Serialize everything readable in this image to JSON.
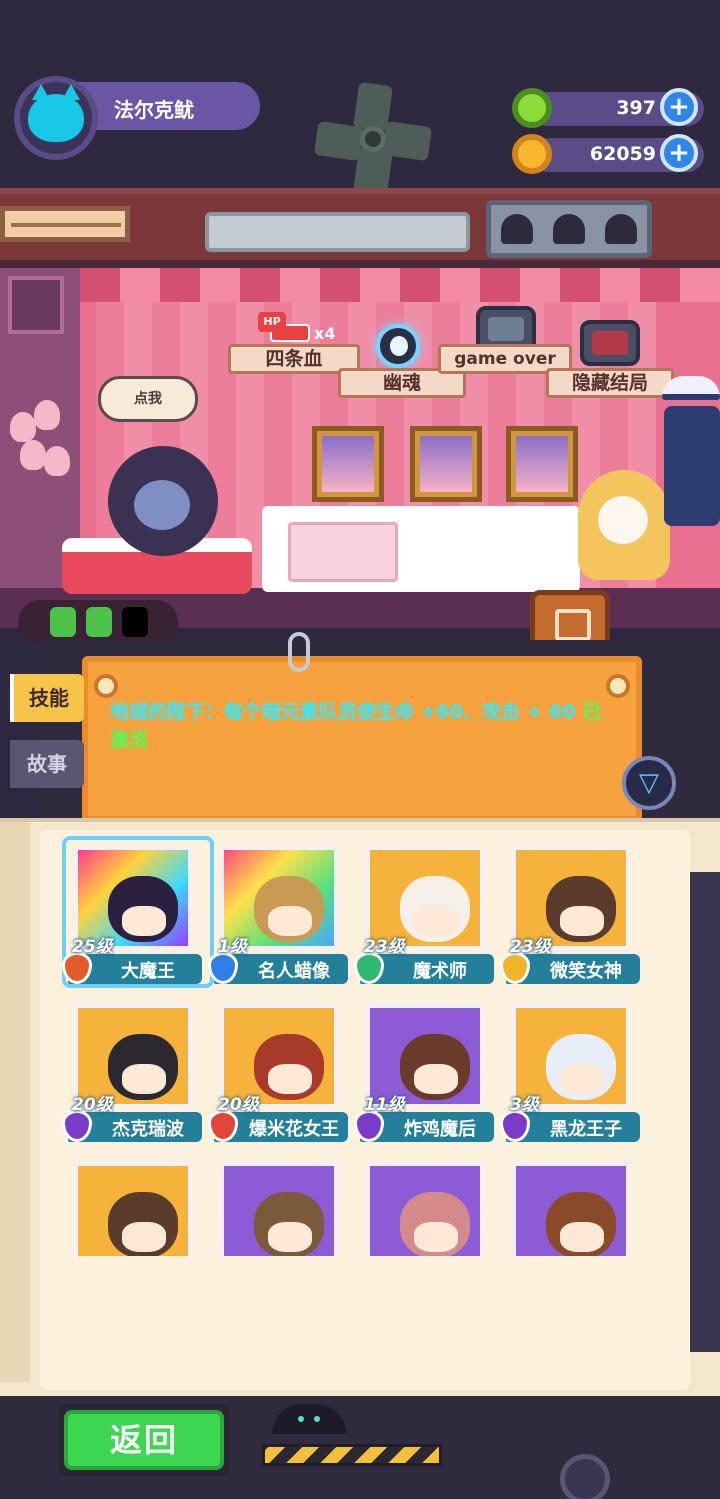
{
  "player": {
    "name": "法尔克鱿",
    "avatar_icon": "cat-avatar-icon"
  },
  "currencies": [
    {
      "icon": "donut-coin-icon",
      "value": "397",
      "color": "#8ddc3c"
    },
    {
      "icon": "planet-coin-icon",
      "value": "62059",
      "color": "#f7b830"
    }
  ],
  "achievements": [
    {
      "label": "四条血",
      "icon_text": "HP",
      "multiplier": "x4"
    },
    {
      "label": "幽魂",
      "icon": "ghost-skull-icon"
    },
    {
      "label": "game over",
      "icon": "tv-grave-icon"
    },
    {
      "label": "隐藏结局",
      "icon": "tv-hidden-icon"
    }
  ],
  "speech_bubble": "点我",
  "battery": {
    "charged": 2,
    "total": 3
  },
  "tabs": {
    "skill": "技能",
    "story": "故事"
  },
  "skill": {
    "text": "地城的陛下：每个暗元素队员使生命 +60、攻击 + 60 ",
    "status": "已激活"
  },
  "characters": [
    {
      "level": "25级",
      "name": "大魔王",
      "element_color": "#e35b2a",
      "bg": "linear-gradient(135deg,#ff3c8b,#ffd23c,#3cd9ff,#9a3cff)",
      "face": "#2b2040",
      "selected": true
    },
    {
      "level": "1级",
      "name": "名人蜡像",
      "element_color": "#2f7fe8",
      "bg": "linear-gradient(135deg,#ff4a7a,#ffe14a,#5ae07a,#4aa6ff)",
      "face": "#c89a54",
      "selected": false
    },
    {
      "level": "23级",
      "name": "魔术师",
      "element_color": "#2fb874",
      "bg": "#f5b33c",
      "face": "#f4f0e8",
      "selected": false
    },
    {
      "level": "23级",
      "name": "微笑女神",
      "element_color": "#f0b429",
      "bg": "#f5b33c",
      "face": "#5a3b2c",
      "selected": false
    },
    {
      "level": "20级",
      "name": "杰克瑞波",
      "element_color": "#7a3cc8",
      "bg": "#f5b33c",
      "face": "#2b2830",
      "selected": false
    },
    {
      "level": "20级",
      "name": "爆米花女王",
      "element_color": "#e0453a",
      "bg": "#f5b33c",
      "face": "#a83a2a",
      "selected": false
    },
    {
      "level": "11级",
      "name": "炸鸡魔后",
      "element_color": "#7a3cc8",
      "bg": "#8e5bd6",
      "face": "#6a3a2a",
      "selected": false
    },
    {
      "level": "3级",
      "name": "黑龙王子",
      "element_color": "#7a3cc8",
      "bg": "#f5b33c",
      "face": "#e8eef8",
      "selected": false
    },
    {
      "level": "",
      "name": "",
      "element_color": "#f0b429",
      "bg": "#f5b33c",
      "face": "#5a3b2c",
      "selected": false
    },
    {
      "level": "",
      "name": "",
      "element_color": "#f0b429",
      "bg": "#8e5bd6",
      "face": "#7a5a3a",
      "selected": false
    },
    {
      "level": "",
      "name": "",
      "element_color": "#f0b429",
      "bg": "#8e5bd6",
      "face": "#d48a8a",
      "selected": false
    },
    {
      "level": "",
      "name": "",
      "element_color": "#f0b429",
      "bg": "#8e5bd6",
      "face": "#8a4a2a",
      "selected": false
    }
  ],
  "back_button": "返回",
  "colors": {
    "accent_cyan": "#33e8ff",
    "active_green": "#4cff5a",
    "board_orange": "#f6a23f"
  }
}
